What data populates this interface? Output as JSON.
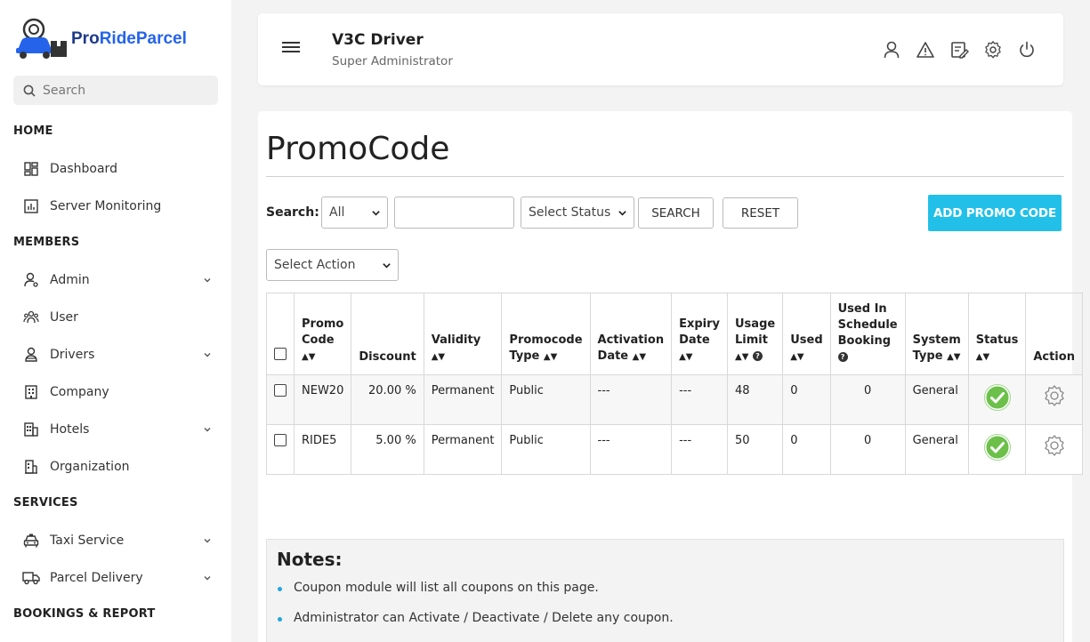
{
  "brand": {
    "name_part1": "Pro",
    "name_part2": "RideParcel"
  },
  "sidebar": {
    "search_placeholder": "Search",
    "sections": {
      "home": "HOME",
      "members": "MEMBERS",
      "services": "SERVICES",
      "bookings": "BOOKINGS & REPORT"
    },
    "items": [
      {
        "label": "Dashboard"
      },
      {
        "label": "Server Monitoring"
      },
      {
        "label": "Admin"
      },
      {
        "label": "User"
      },
      {
        "label": "Drivers"
      },
      {
        "label": "Company"
      },
      {
        "label": "Hotels"
      },
      {
        "label": "Organization"
      },
      {
        "label": "Taxi Service"
      },
      {
        "label": "Parcel Delivery"
      }
    ]
  },
  "header": {
    "title": "V3C Driver",
    "subtitle": "Super Administrator",
    "icons": [
      "user-icon",
      "alert-triangle-icon",
      "edit-note-icon",
      "gear-icon",
      "power-icon"
    ]
  },
  "main": {
    "page_title": "PromoCode",
    "search_label": "Search:",
    "filter_value": "All",
    "status_value": "Select Status",
    "search_button": "SEARCH",
    "reset_button": "RESET",
    "add_button": "ADD PROMO CODE",
    "action_value": "Select Action"
  },
  "table": {
    "headers": {
      "code_1": "Promo",
      "code_2": "Code",
      "discount": "Discount",
      "validity": "Validity",
      "type_1": "Promocode",
      "type_2": "Type",
      "activation_1": "Activation",
      "activation_2": "Date",
      "expiry_1": "Expiry",
      "expiry_2": "Date",
      "usage_1": "Usage",
      "usage_2": "Limit",
      "used": "Used",
      "schedule_1": "Used In",
      "schedule_2": "Schedule",
      "schedule_3": "Booking",
      "system_1": "System",
      "system_2": "Type",
      "status": "Status",
      "action": "Action"
    },
    "rows": [
      {
        "code": "NEW20",
        "discount": "20.00 %",
        "validity": "Permanent",
        "type": "Public",
        "activation": "---",
        "expiry": "---",
        "usage_limit": "48",
        "used": "0",
        "schedule_used": "0",
        "system_type": "General",
        "status": "active"
      },
      {
        "code": "RIDE5",
        "discount": "5.00 %",
        "validity": "Permanent",
        "type": "Public",
        "activation": "---",
        "expiry": "---",
        "usage_limit": "50",
        "used": "0",
        "schedule_used": "0",
        "system_type": "General",
        "status": "active"
      }
    ]
  },
  "notes": {
    "title": "Notes:",
    "items": [
      "Coupon module will list all coupons on this page.",
      "Administrator can Activate / Deactivate / Delete any coupon."
    ]
  },
  "colors": {
    "accent": "#22c0e8",
    "brand_blue": "#2563eb",
    "status_green": "#6cc04a"
  }
}
